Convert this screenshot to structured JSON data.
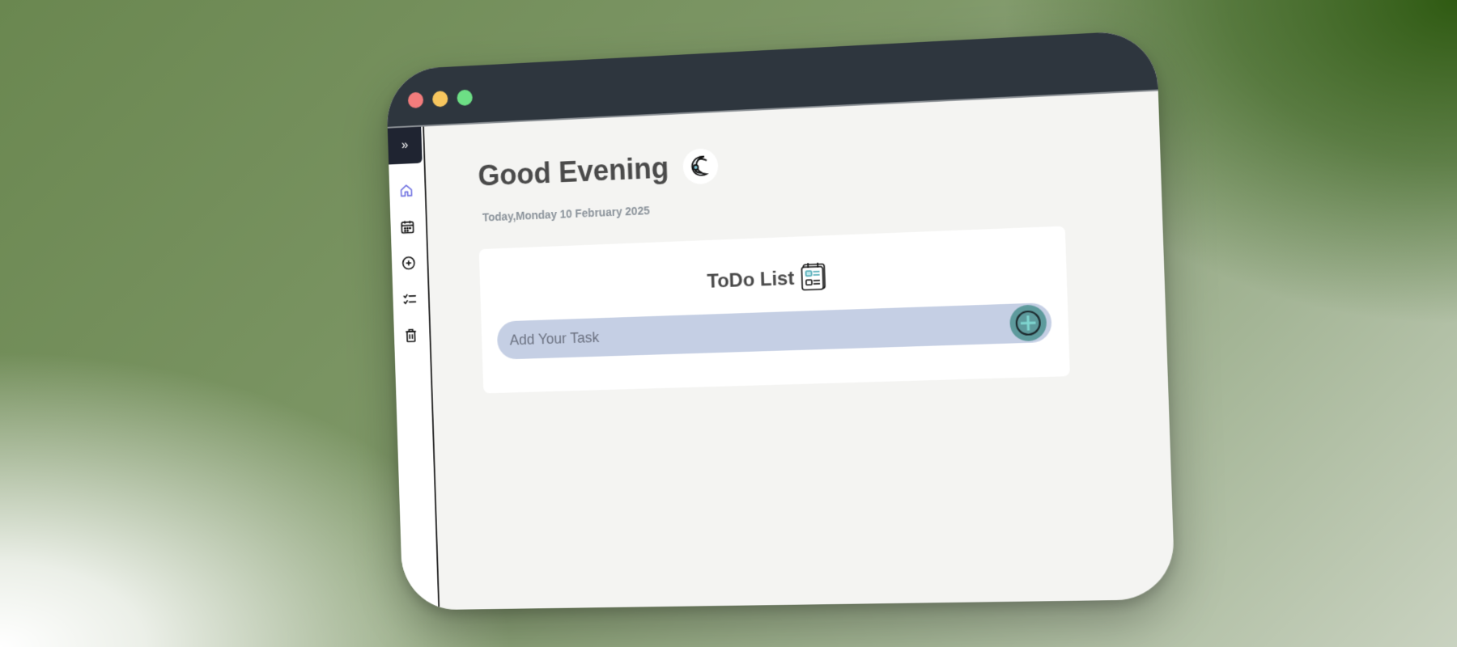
{
  "window": {
    "controls": {
      "close": "red-dot",
      "minimize": "yellow-dot",
      "maximize": "green-dot"
    }
  },
  "sidebar": {
    "toggle_label": "»",
    "items": [
      {
        "icon": "home-icon",
        "active": true
      },
      {
        "icon": "calendar-icon"
      },
      {
        "icon": "add-circle-icon"
      },
      {
        "icon": "checklist-icon"
      },
      {
        "icon": "trash-icon"
      }
    ]
  },
  "header": {
    "greeting": "Good Evening",
    "greeting_icon": "moon-icon",
    "date": "Today,Monday 10 February 2025"
  },
  "todo": {
    "title": "ToDo List",
    "title_icon": "clipboard-icon",
    "input_placeholder": "Add Your Task",
    "input_value": "",
    "add_button_icon": "plus-circle-icon"
  },
  "colors": {
    "titlebar": "#2e363e",
    "sidebar_toggle": "#1f2431",
    "nav_active": "#6d6fe0",
    "input_bg": "#c5cfe4",
    "add_button": "#5d9a9c",
    "content_bg": "#f4f4f2",
    "card_bg": "#ffffff"
  }
}
